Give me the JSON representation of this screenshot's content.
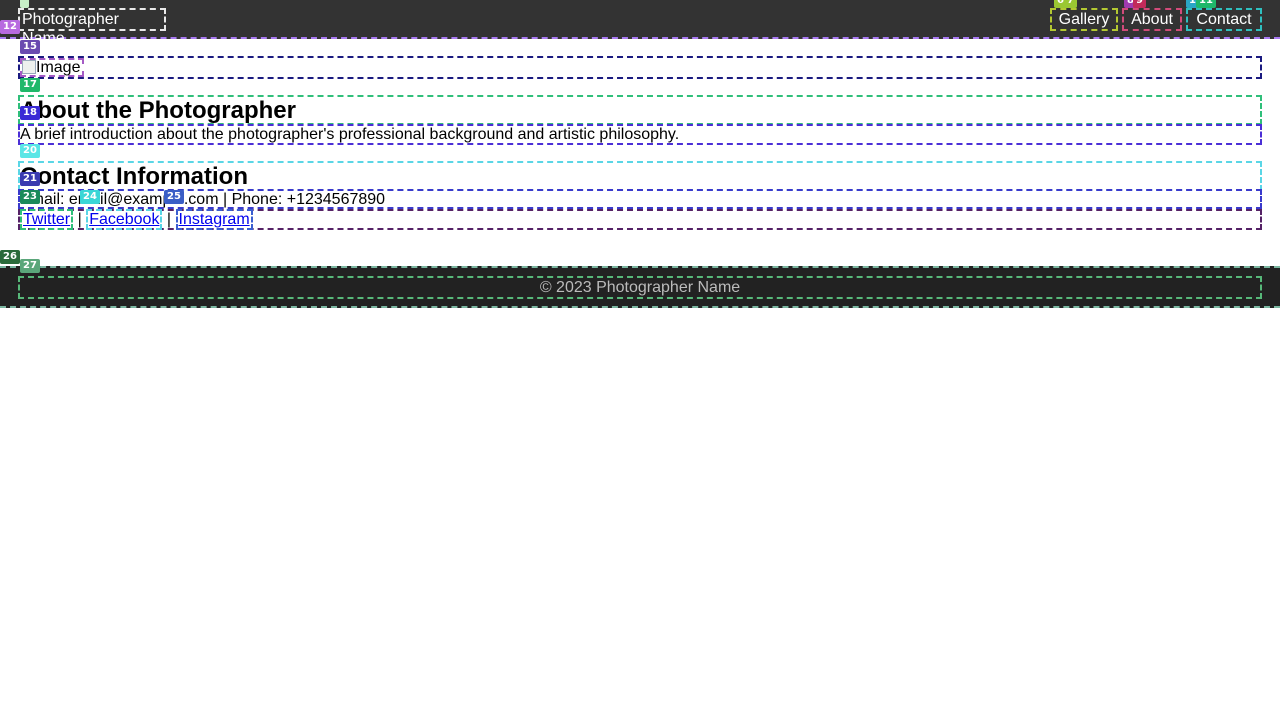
{
  "header": {
    "logo": "Photographer Name",
    "nav": [
      {
        "label": "Gallery"
      },
      {
        "label": "About"
      },
      {
        "label": "Contact"
      }
    ]
  },
  "main": {
    "image_alt": "Image",
    "about": {
      "heading": "About the Photographer",
      "text": "A brief introduction about the photographer's professional background and artistic philosophy."
    },
    "contact": {
      "heading": "Contact Information",
      "text": "Email: email@example.com | Phone: +1234567890",
      "separator": "|",
      "social": [
        {
          "label": "Twitter"
        },
        {
          "label": "Facebook"
        },
        {
          "label": "Instagram"
        }
      ]
    }
  },
  "footer": {
    "text": "© 2023 Photographer Name"
  },
  "overlay_badges": {
    "b12": "12",
    "b15": "15",
    "b17": "17",
    "b18": "18",
    "b20": "20",
    "b21": "21",
    "b23": "23",
    "b24": "24",
    "b25": "25",
    "b26": "26",
    "b27": "27",
    "b6": "6",
    "b7": "7",
    "b8": "8",
    "b9": "9",
    "b10": "10",
    "b11": "11"
  },
  "colors": {
    "header_bg": "#333333",
    "footer_bg": "#222222",
    "link": "#0000ee"
  }
}
